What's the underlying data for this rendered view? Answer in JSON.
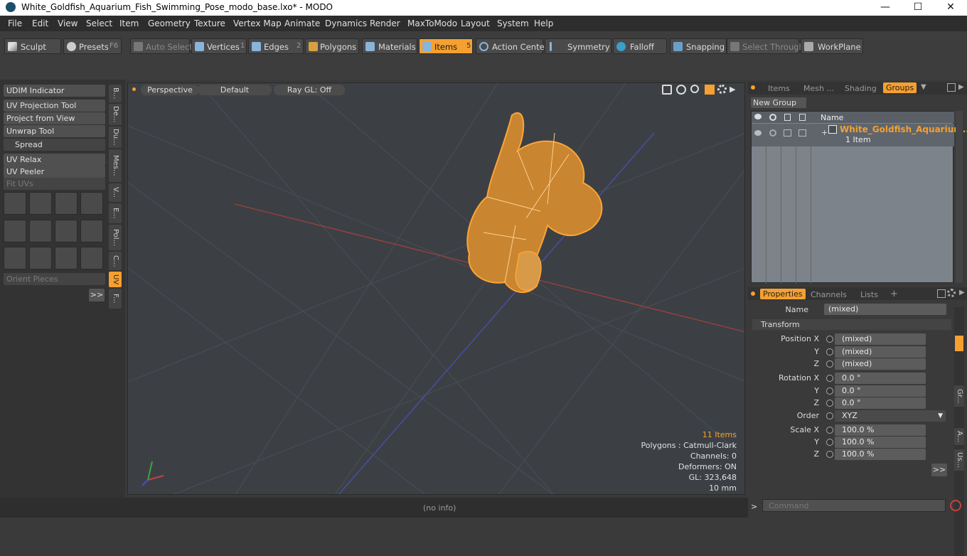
{
  "window": {
    "title": "White_Goldfish_Aquarium_Fish_Swimming_Pose_modo_base.lxo* - MODO",
    "minimize": "—",
    "maximize": "☐",
    "close": "✕"
  },
  "menu": [
    "File",
    "Edit",
    "View",
    "Select",
    "Item",
    "Geometry",
    "Texture",
    "Vertex Map",
    "Animate",
    "Dynamics",
    "Render",
    "MaxToModo",
    "Layout",
    "System",
    "Help"
  ],
  "toolbar": {
    "sculpt": "Sculpt",
    "presets": "Presets",
    "presets_key": "F6",
    "auto_select": "Auto Select",
    "vertices": "Vertices",
    "vertices_key": "1",
    "edges": "Edges",
    "edges_key": "2",
    "polygons": "Polygons",
    "materials": "Materials",
    "items": "Items",
    "items_key": "5",
    "action_center": "Action Center",
    "symmetry": "Symmetry",
    "falloff": "Falloff",
    "snapping": "Snapping",
    "select_through": "Select Through",
    "workplane": "WorkPlane"
  },
  "left_tools": {
    "udim": "UDIM Indicator",
    "uv_projection": "UV Projection Tool",
    "project_view": "Project from View",
    "unwrap": "Unwrap Tool",
    "spread": "Spread",
    "uv_relax": "UV Relax",
    "uv_peeler": "UV Peeler",
    "fit_uvs": "Fit UVs",
    "orient": "Orient Pieces",
    "more": ">>",
    "vtabs": [
      "B...",
      "De...",
      "Du...",
      "Mes...",
      "V...",
      "E...",
      "Pol...",
      "C...",
      "UV",
      "F..."
    ]
  },
  "viewport": {
    "view": "Perspective",
    "shading": "Default",
    "raygl": "Ray GL: Off",
    "stats": {
      "items": "11 Items",
      "polygons": "Polygons : Catmull-Clark",
      "channels": "Channels: 0",
      "deformers": "Deformers: ON",
      "gl": "GL: 323,648",
      "scale": "10 mm"
    }
  },
  "groups_panel": {
    "tabs": [
      "Items",
      "Mesh ...",
      "Shading",
      "Groups"
    ],
    "active_tab": "Groups",
    "new_group": "New Group",
    "col_name": "Name",
    "group_name": "White_Goldfish_Aquarium...",
    "group_count": "1 Item"
  },
  "properties": {
    "tabs": [
      "Properties",
      "Channels",
      "Lists"
    ],
    "add_tab": "+",
    "name_label": "Name",
    "name_value": "(mixed)",
    "transform": "Transform",
    "position_x_label": "Position X",
    "y_label": "Y",
    "z_label": "Z",
    "position_x": "(mixed)",
    "position_y": "(mixed)",
    "position_z": "(mixed)",
    "rotation_x_label": "Rotation X",
    "rotation_x": "0.0 °",
    "rotation_y": "0.0 °",
    "rotation_z": "0.0 °",
    "order_label": "Order",
    "order_value": "XYZ",
    "scale_x_label": "Scale X",
    "scale_x": "100.0 %",
    "scale_y": "100.0 %",
    "scale_z": "100.0 %",
    "more": ">>",
    "side_tabs": [
      "Gr...",
      "A...",
      "Us..."
    ]
  },
  "status": {
    "info": "(no info)",
    "command_placeholder": "Command",
    "prompt": ">"
  },
  "colors": {
    "accent": "#f5a030",
    "panel": "#3a3a3a",
    "viewport": "#3c4045"
  }
}
